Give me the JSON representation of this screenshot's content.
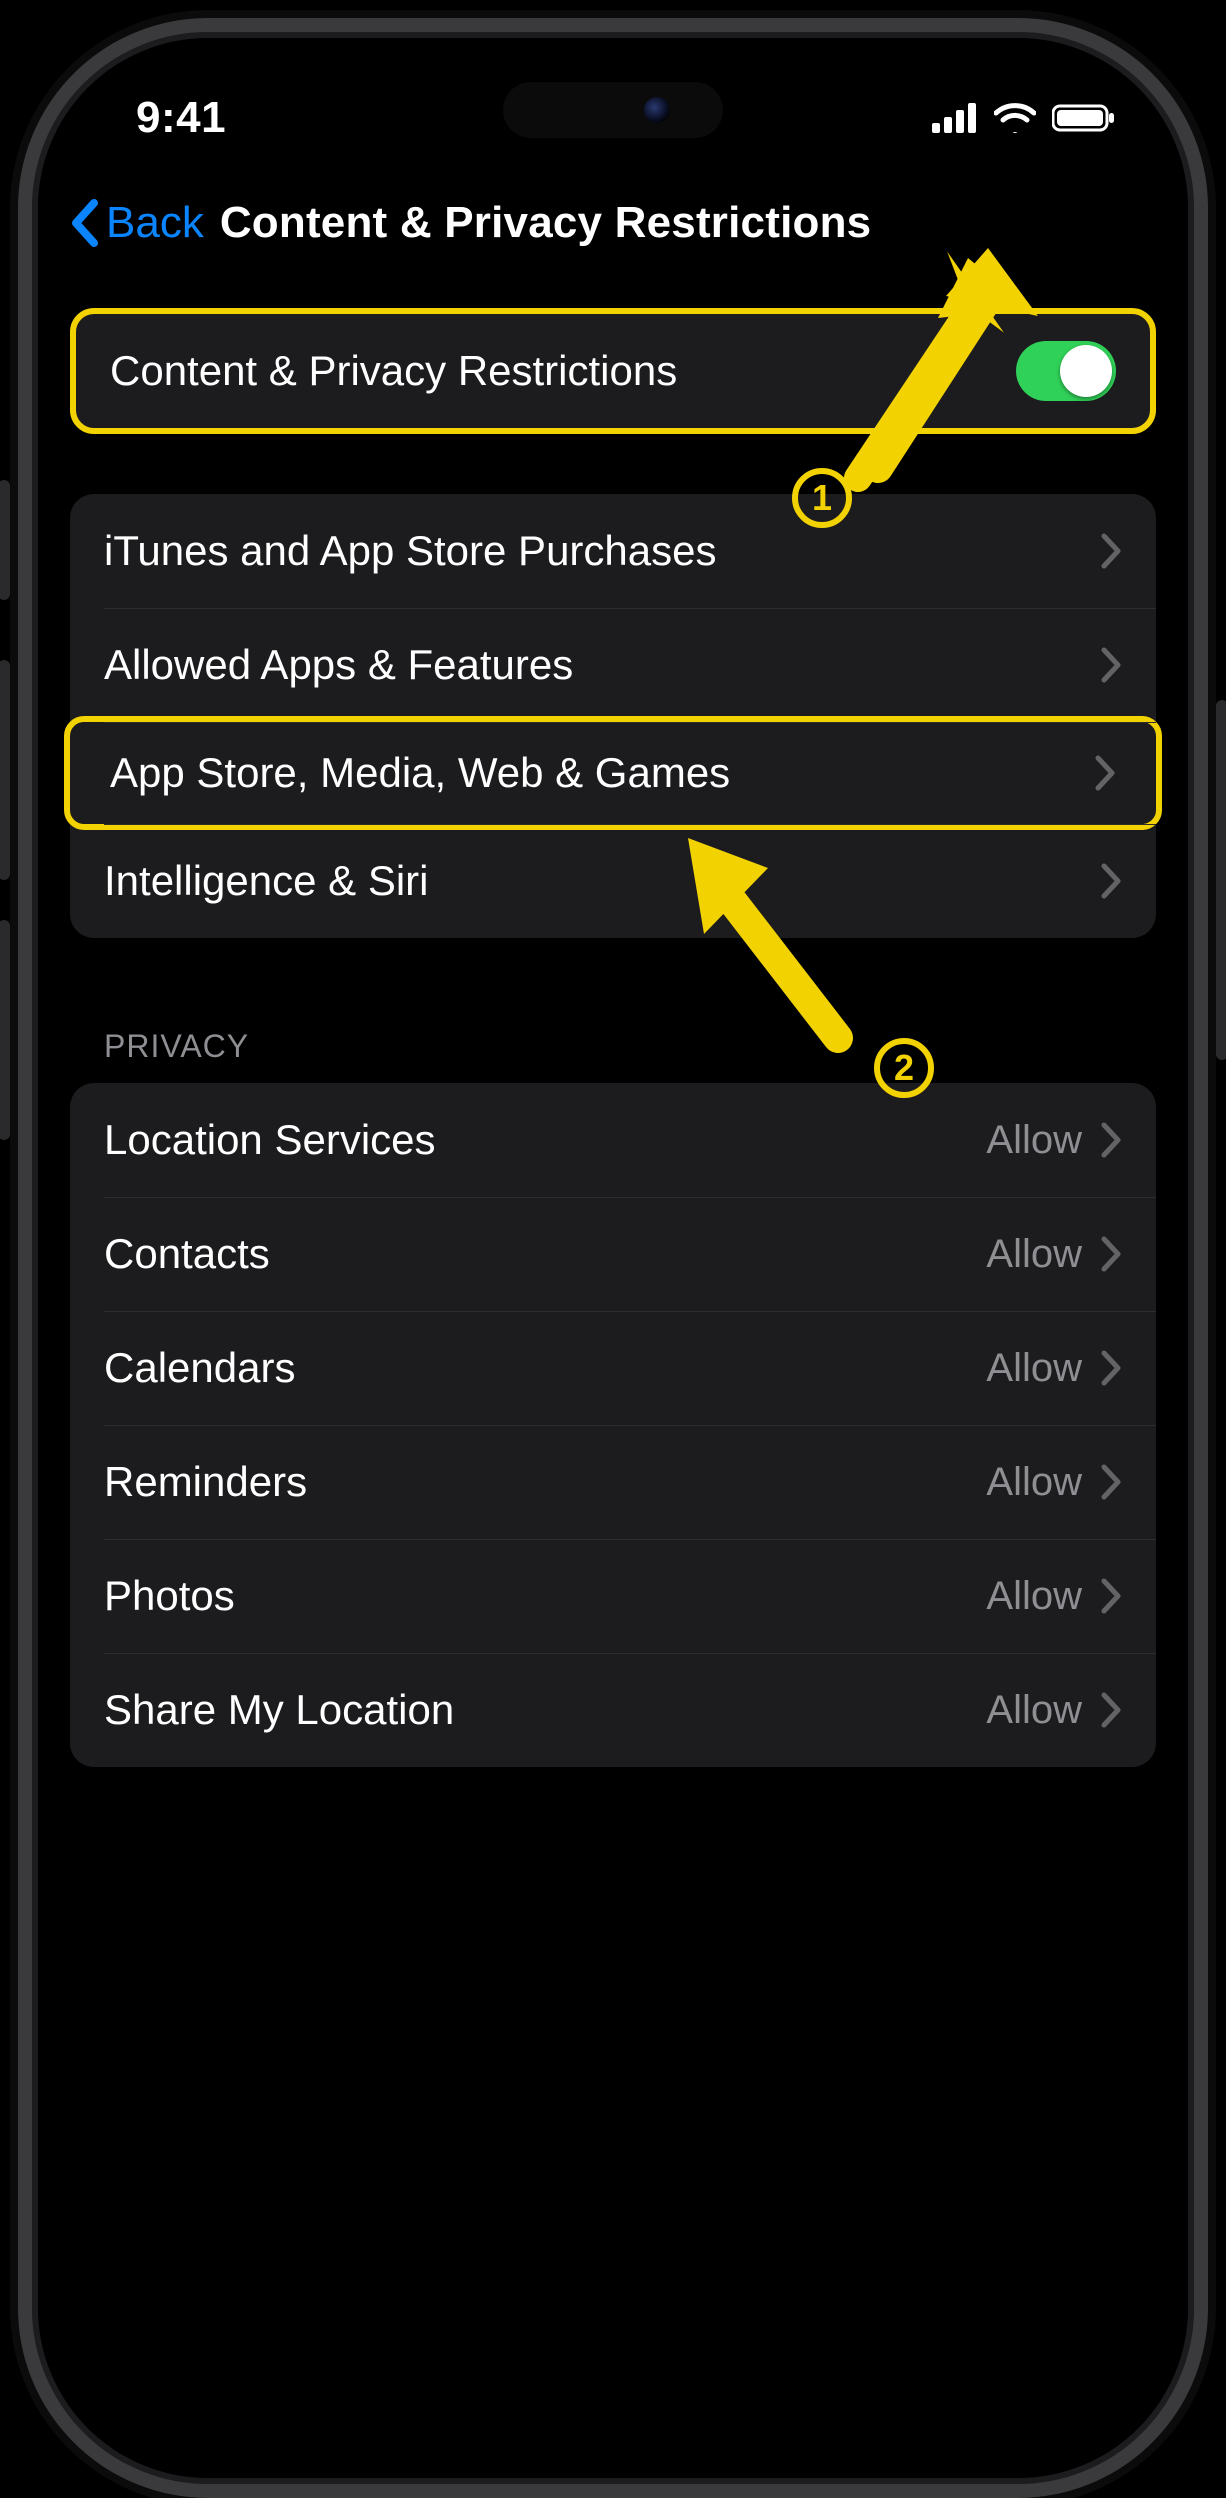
{
  "status": {
    "time": "9:41"
  },
  "nav": {
    "back_label": "Back",
    "title": "Content & Privacy Restrictions"
  },
  "section_toggle": {
    "label": "Content & Privacy Restrictions",
    "enabled": true
  },
  "section_main": {
    "items": [
      {
        "label": "iTunes and App Store Purchases"
      },
      {
        "label": "Allowed Apps & Features"
      },
      {
        "label": "App Store, Media, Web & Games"
      },
      {
        "label": "Intelligence & Siri"
      }
    ]
  },
  "section_privacy": {
    "header": "Privacy",
    "items": [
      {
        "label": "Location Services",
        "value": "Allow"
      },
      {
        "label": "Contacts",
        "value": "Allow"
      },
      {
        "label": "Calendars",
        "value": "Allow"
      },
      {
        "label": "Reminders",
        "value": "Allow"
      },
      {
        "label": "Photos",
        "value": "Allow"
      },
      {
        "label": "Share My Location",
        "value": "Allow"
      }
    ]
  },
  "annotations": {
    "step1": "1",
    "step2": "2"
  }
}
